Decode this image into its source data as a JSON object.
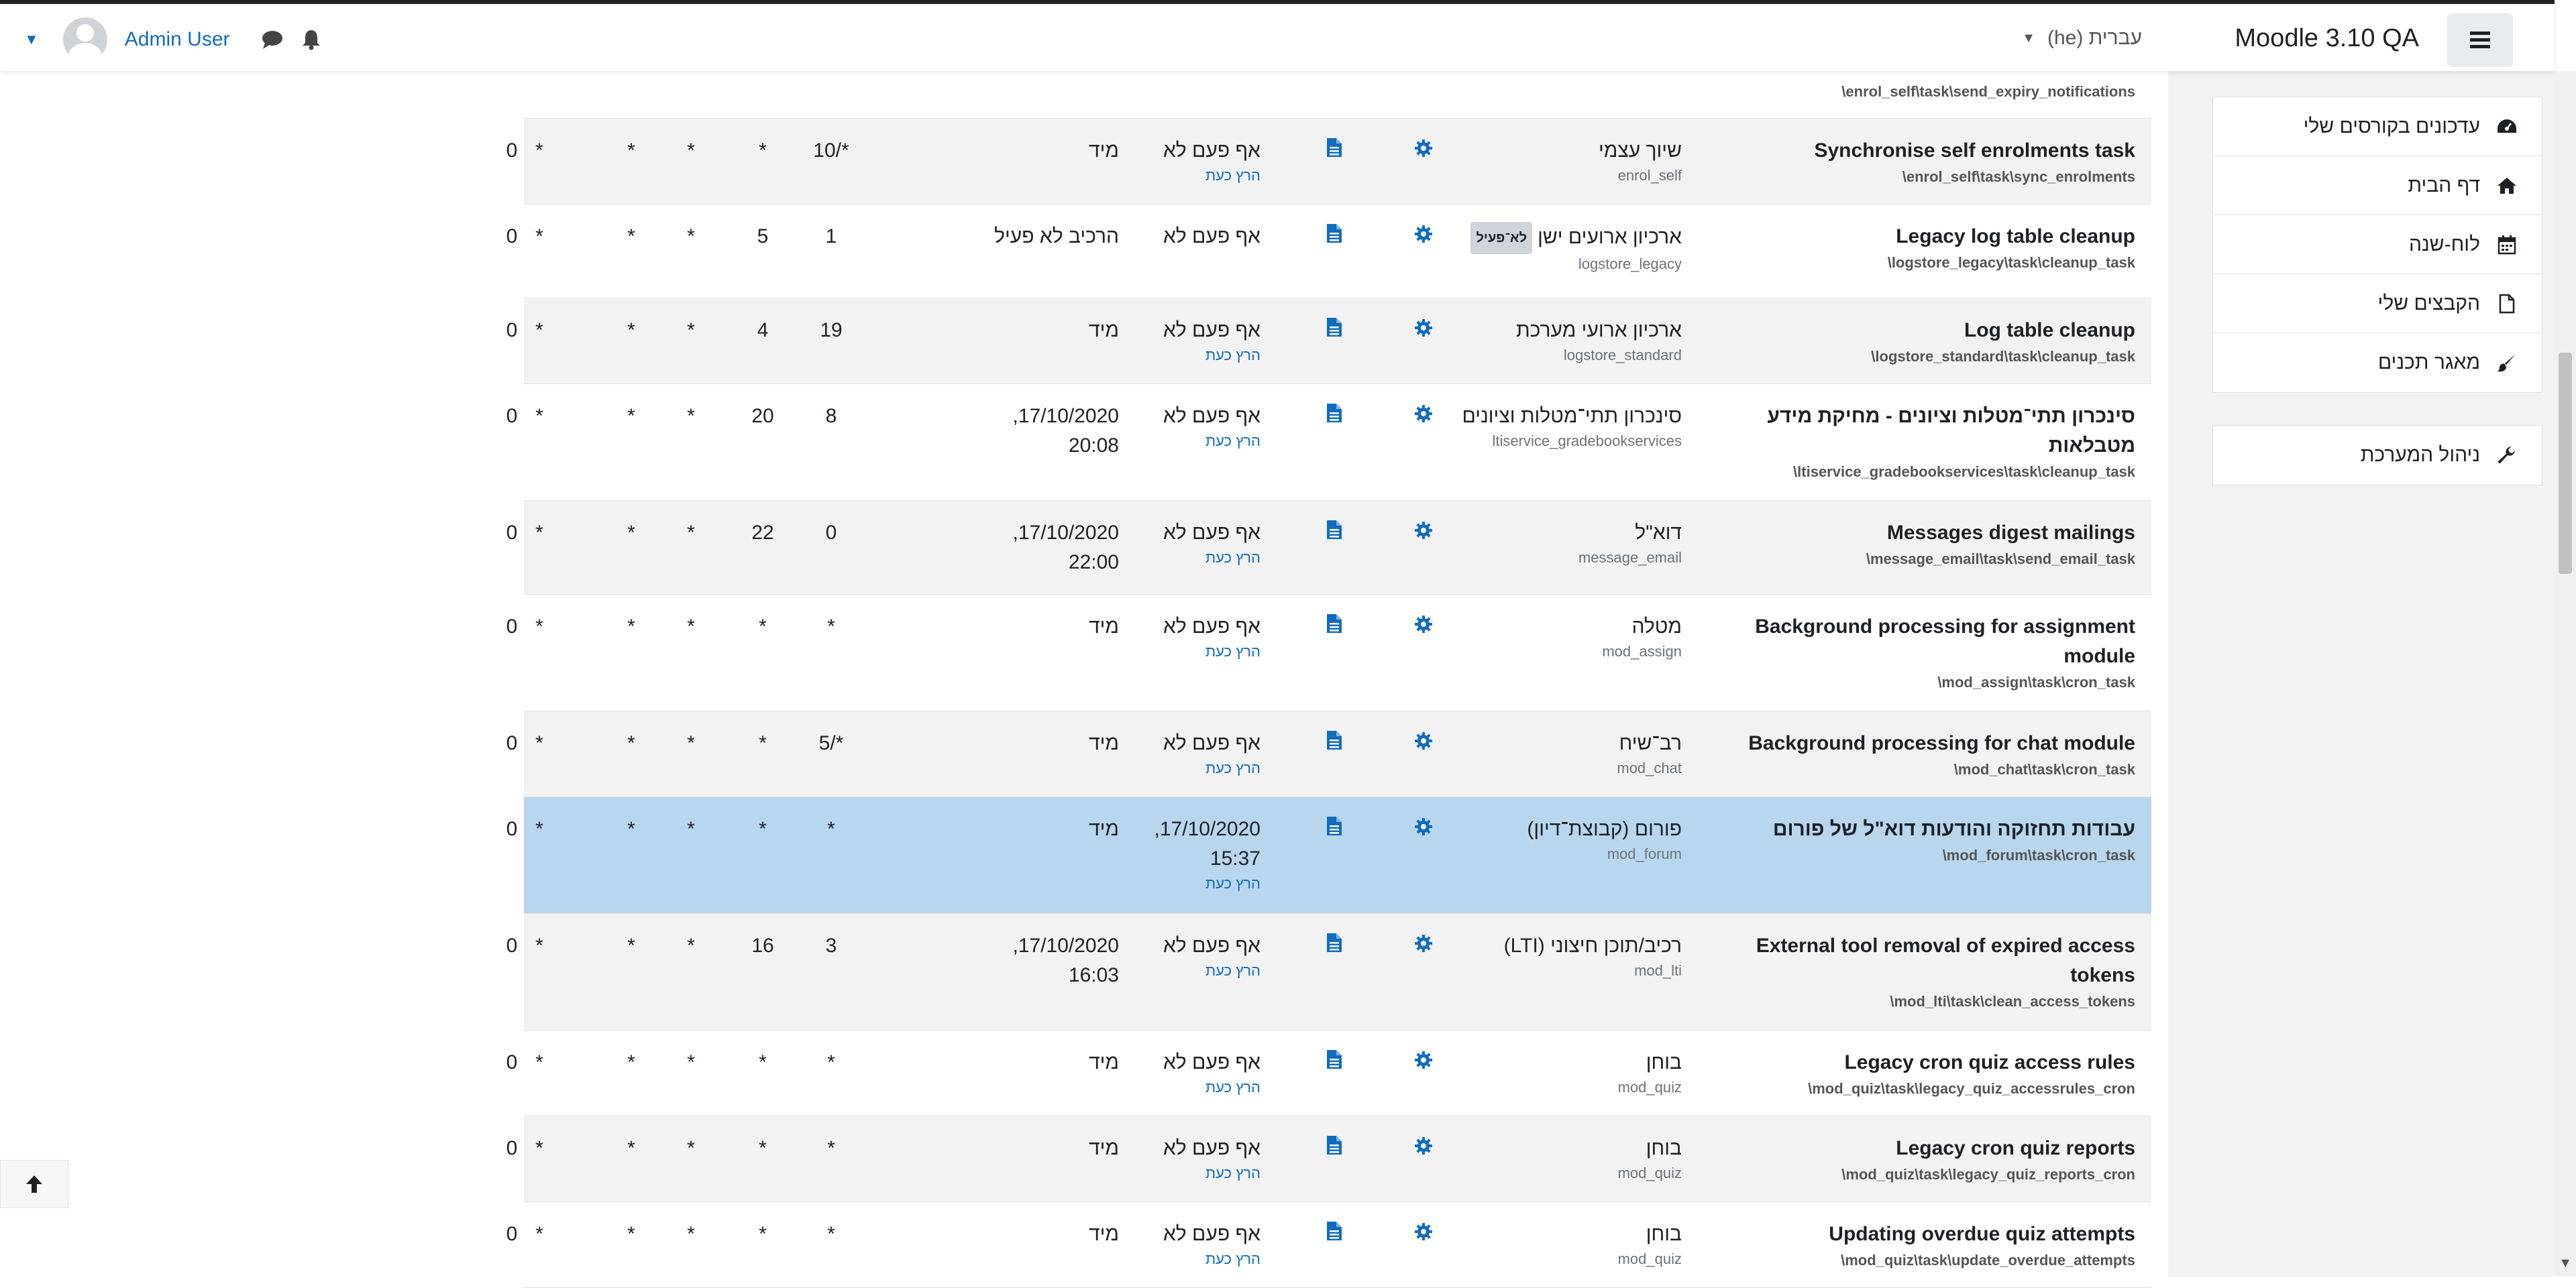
{
  "header": {
    "site_name": "Moodle 3.10 QA",
    "language": "עברית (he)",
    "user_name": "Admin User"
  },
  "nav": {
    "group1": [
      {
        "label": "עדכונים בקורסים שלי",
        "icon": "dashboard-icon"
      },
      {
        "label": "דף הבית",
        "icon": "home-icon"
      },
      {
        "label": "לוח-שנה",
        "icon": "calendar-icon"
      },
      {
        "label": "הקבצים שלי",
        "icon": "file-icon"
      },
      {
        "label": "מאגר תכנים",
        "icon": "paintbrush-icon"
      }
    ],
    "group2": [
      {
        "label": "ניהול המערכת",
        "icon": "wrench-icon"
      }
    ]
  },
  "table": {
    "run_now_label": "הרץ כעת",
    "top_fragment_class": "\\enrol_self\\task\\send_expiry_notifications",
    "rows": [
      {
        "name": "Synchronise self enrolments task",
        "classname": "\\enrol_self\\task\\sync_enrolments",
        "component": "שיוך עצמי",
        "comp_slug": "enrol_self",
        "badge": "",
        "last_run": "אף פעם לא",
        "run_now": true,
        "next_run": "מיד",
        "minute": "*/10",
        "hour": "*",
        "day": "*",
        "month": "*",
        "dow": "*",
        "fail": "0"
      },
      {
        "name": "Legacy log table cleanup",
        "classname": "\\logstore_legacy\\task\\cleanup_task",
        "component": "ארכיון ארועים ישן",
        "comp_slug": "logstore_legacy",
        "badge": "לא־פעיל",
        "last_run": "אף פעם לא",
        "run_now": false,
        "next_run": "הרכיב לא פעיל",
        "minute": "1",
        "hour": "5",
        "day": "*",
        "month": "*",
        "dow": "*",
        "fail": "0"
      },
      {
        "name": "Log table cleanup",
        "classname": "\\logstore_standard\\task\\cleanup_task",
        "component": "ארכיון ארועי מערכת",
        "comp_slug": "logstore_standard",
        "badge": "",
        "last_run": "אף פעם לא",
        "run_now": true,
        "next_run": "מיד",
        "minute": "19",
        "hour": "4",
        "day": "*",
        "month": "*",
        "dow": "*",
        "fail": "0"
      },
      {
        "name": "סינכרון תתי־מטלות וציונים - מחיקת מידע מטבלאות",
        "classname": "\\ltiservice_gradebookservices\\task\\cleanup_task",
        "component": "סינכרון תתי־מטלות וציונים",
        "comp_slug": "ltiservice_gradebookservices",
        "badge": "",
        "last_run": "אף פעם לא",
        "run_now": true,
        "next_run": "17/10/2020, 20:08",
        "minute": "8",
        "hour": "20",
        "day": "*",
        "month": "*",
        "dow": "*",
        "fail": "0"
      },
      {
        "name": "Messages digest mailings",
        "classname": "\\message_email\\task\\send_email_task",
        "component": "דוא\"ל",
        "comp_slug": "message_email",
        "badge": "",
        "last_run": "אף פעם לא",
        "run_now": true,
        "next_run": "17/10/2020, 22:00",
        "minute": "0",
        "hour": "22",
        "day": "*",
        "month": "*",
        "dow": "*",
        "fail": "0"
      },
      {
        "name": "Background processing for assignment module",
        "classname": "\\mod_assign\\task\\cron_task",
        "component": "מטלה",
        "comp_slug": "mod_assign",
        "badge": "",
        "last_run": "אף פעם לא",
        "run_now": true,
        "next_run": "מיד",
        "minute": "*",
        "hour": "*",
        "day": "*",
        "month": "*",
        "dow": "*",
        "fail": "0"
      },
      {
        "name": "Background processing for chat module",
        "classname": "\\mod_chat\\task\\cron_task",
        "component": "רב־שיח",
        "comp_slug": "mod_chat",
        "badge": "",
        "last_run": "אף פעם לא",
        "run_now": true,
        "next_run": "מיד",
        "minute": "*/5",
        "hour": "*",
        "day": "*",
        "month": "*",
        "dow": "*",
        "fail": "0"
      },
      {
        "name": "עבודות תחזוקה והודעות דוא\"ל של פורום",
        "classname": "\\mod_forum\\task\\cron_task",
        "component": "פורום (קבוצת־דיון)",
        "comp_slug": "mod_forum",
        "badge": "",
        "last_run": "17/10/2020, 15:37",
        "run_now": true,
        "next_run": "מיד",
        "minute": "*",
        "hour": "*",
        "day": "*",
        "month": "*",
        "dow": "*",
        "fail": "0"
      },
      {
        "name": "External tool removal of expired access tokens",
        "classname": "\\mod_lti\\task\\clean_access_tokens",
        "component": "רכיב/תוכן חיצוני (LTI)",
        "comp_slug": "mod_lti",
        "badge": "",
        "last_run": "אף פעם לא",
        "run_now": true,
        "next_run": "17/10/2020, 16:03",
        "minute": "3",
        "hour": "16",
        "day": "*",
        "month": "*",
        "dow": "*",
        "fail": "0"
      },
      {
        "name": "Legacy cron quiz access rules",
        "classname": "\\mod_quiz\\task\\legacy_quiz_accessrules_cron",
        "component": "בוחן",
        "comp_slug": "mod_quiz",
        "badge": "",
        "last_run": "אף פעם לא",
        "run_now": true,
        "next_run": "מיד",
        "minute": "*",
        "hour": "*",
        "day": "*",
        "month": "*",
        "dow": "*",
        "fail": "0"
      },
      {
        "name": "Legacy cron quiz reports",
        "classname": "\\mod_quiz\\task\\legacy_quiz_reports_cron",
        "component": "בוחן",
        "comp_slug": "mod_quiz",
        "badge": "",
        "last_run": "אף פעם לא",
        "run_now": true,
        "next_run": "מיד",
        "minute": "*",
        "hour": "*",
        "day": "*",
        "month": "*",
        "dow": "*",
        "fail": "0"
      },
      {
        "name": "Updating overdue quiz attempts",
        "classname": "\\mod_quiz\\task\\update_overdue_attempts",
        "component": "בוחן",
        "comp_slug": "mod_quiz",
        "badge": "",
        "last_run": "אף פעם לא",
        "run_now": true,
        "next_run": "מיד",
        "minute": "*",
        "hour": "*",
        "day": "*",
        "month": "*",
        "dow": "*",
        "fail": "0"
      }
    ]
  }
}
